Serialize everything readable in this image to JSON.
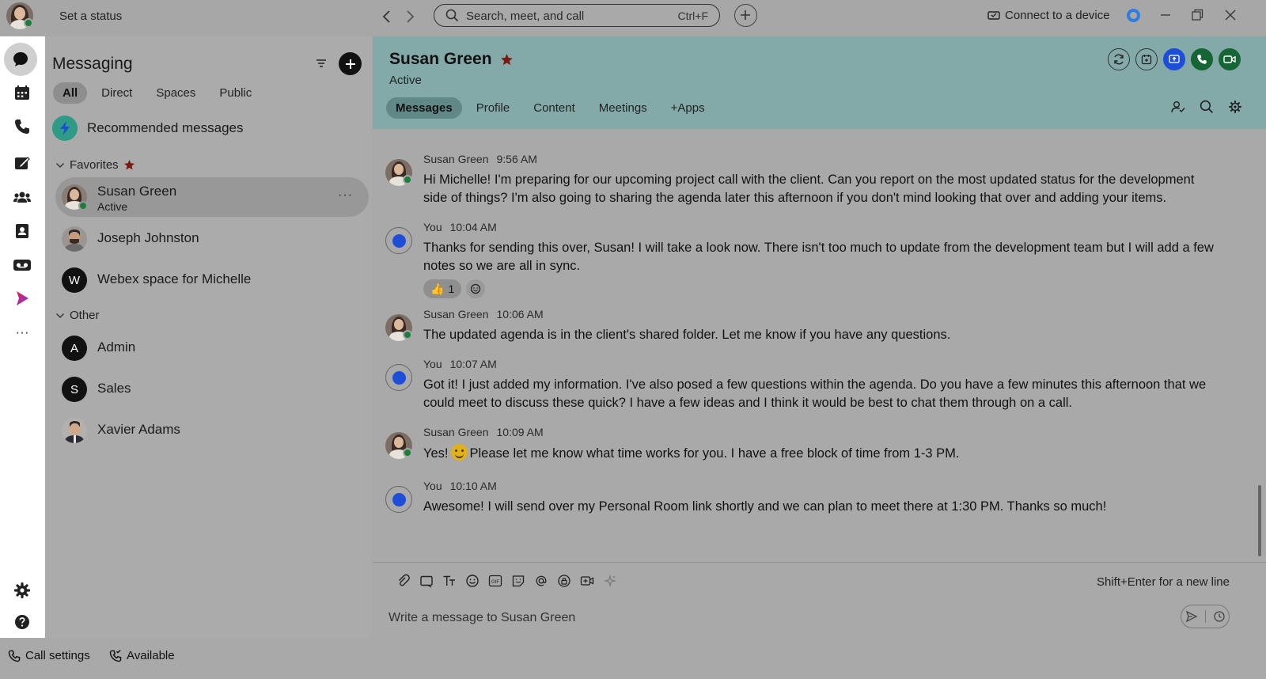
{
  "titlebar": {
    "status_label": "Set a status",
    "search_placeholder": "Search, meet, and call",
    "search_shortcut": "Ctrl+F",
    "connect_label": "Connect to a device"
  },
  "rail": {
    "items": [
      "messaging-icon",
      "calendar-icon",
      "phone-icon",
      "whiteboard-icon",
      "teams-icon",
      "contacts-icon",
      "voicemail-icon",
      "webex-apps-icon",
      "more-icon"
    ],
    "more_label": "···"
  },
  "list": {
    "title": "Messaging",
    "tabs": [
      "All",
      "Direct",
      "Spaces",
      "Public"
    ],
    "recommended": "Recommended messages",
    "favorites_label": "Favorites",
    "other_label": "Other",
    "favorites": [
      {
        "name": "Susan Green",
        "status": "Active",
        "avatar": "photo"
      },
      {
        "name": "Joseph Johnston",
        "avatar": "photo"
      },
      {
        "name": "Webex space for Michelle",
        "avatar": "W"
      }
    ],
    "others": [
      {
        "name": "Admin",
        "avatar": "A"
      },
      {
        "name": "Sales",
        "avatar": "S"
      },
      {
        "name": "Xavier Adams",
        "avatar": "photo"
      }
    ],
    "more_label": "···"
  },
  "conversation": {
    "name": "Susan Green",
    "status": "Active",
    "tabs": [
      "Messages",
      "Profile",
      "Content",
      "Meetings",
      "+Apps"
    ],
    "messages": [
      {
        "sender": "Susan Green",
        "time": "9:56 AM",
        "text": "Hi Michelle! I'm preparing for our upcoming project call with the client. Can you report on the most updated status for the development side of things? I'm also going to sharing the agenda later this afternoon if you don't mind looking that over and adding your items."
      },
      {
        "sender": "You",
        "time": "10:04 AM",
        "text": "Thanks for sending this over, Susan! I will take a look now. There isn't too much to update from the development team but I will add a few notes so we are all in sync.",
        "reaction_emoji": "👍",
        "reaction_count": "1"
      },
      {
        "sender": "Susan Green",
        "time": "10:06 AM",
        "text": "The updated agenda is in the client's shared folder. Let me know if you have any questions."
      },
      {
        "sender": "You",
        "time": "10:07 AM",
        "text": "Got it! I just added my information. I've also posed a few questions within the agenda. Do you have a few minutes this afternoon that we could meet to discuss these quick? I have a few ideas and I think it would be best to chat them through on a call."
      },
      {
        "sender": "Susan Green",
        "time": "10:09 AM",
        "text_before": "Yes!",
        "text_after": "Please let me know what time works for you. I have a free block of time from 1-3 PM."
      },
      {
        "sender": "You",
        "time": "10:10 AM",
        "text": "Awesome! I will send over my Personal Room link shortly and we can plan to meet there at 1:30 PM. Thanks so much!"
      }
    ]
  },
  "composer": {
    "hint": "Shift+Enter for a new line",
    "placeholder": "Write a message to Susan Green"
  },
  "bottombar": {
    "call_settings": "Call settings",
    "availability": "Available"
  },
  "colors": {
    "header_teal": "#83a9a9",
    "presence_green": "#1b7f3a",
    "you_blue": "#1d4ed8",
    "favorite_star": "#7a1a10"
  }
}
